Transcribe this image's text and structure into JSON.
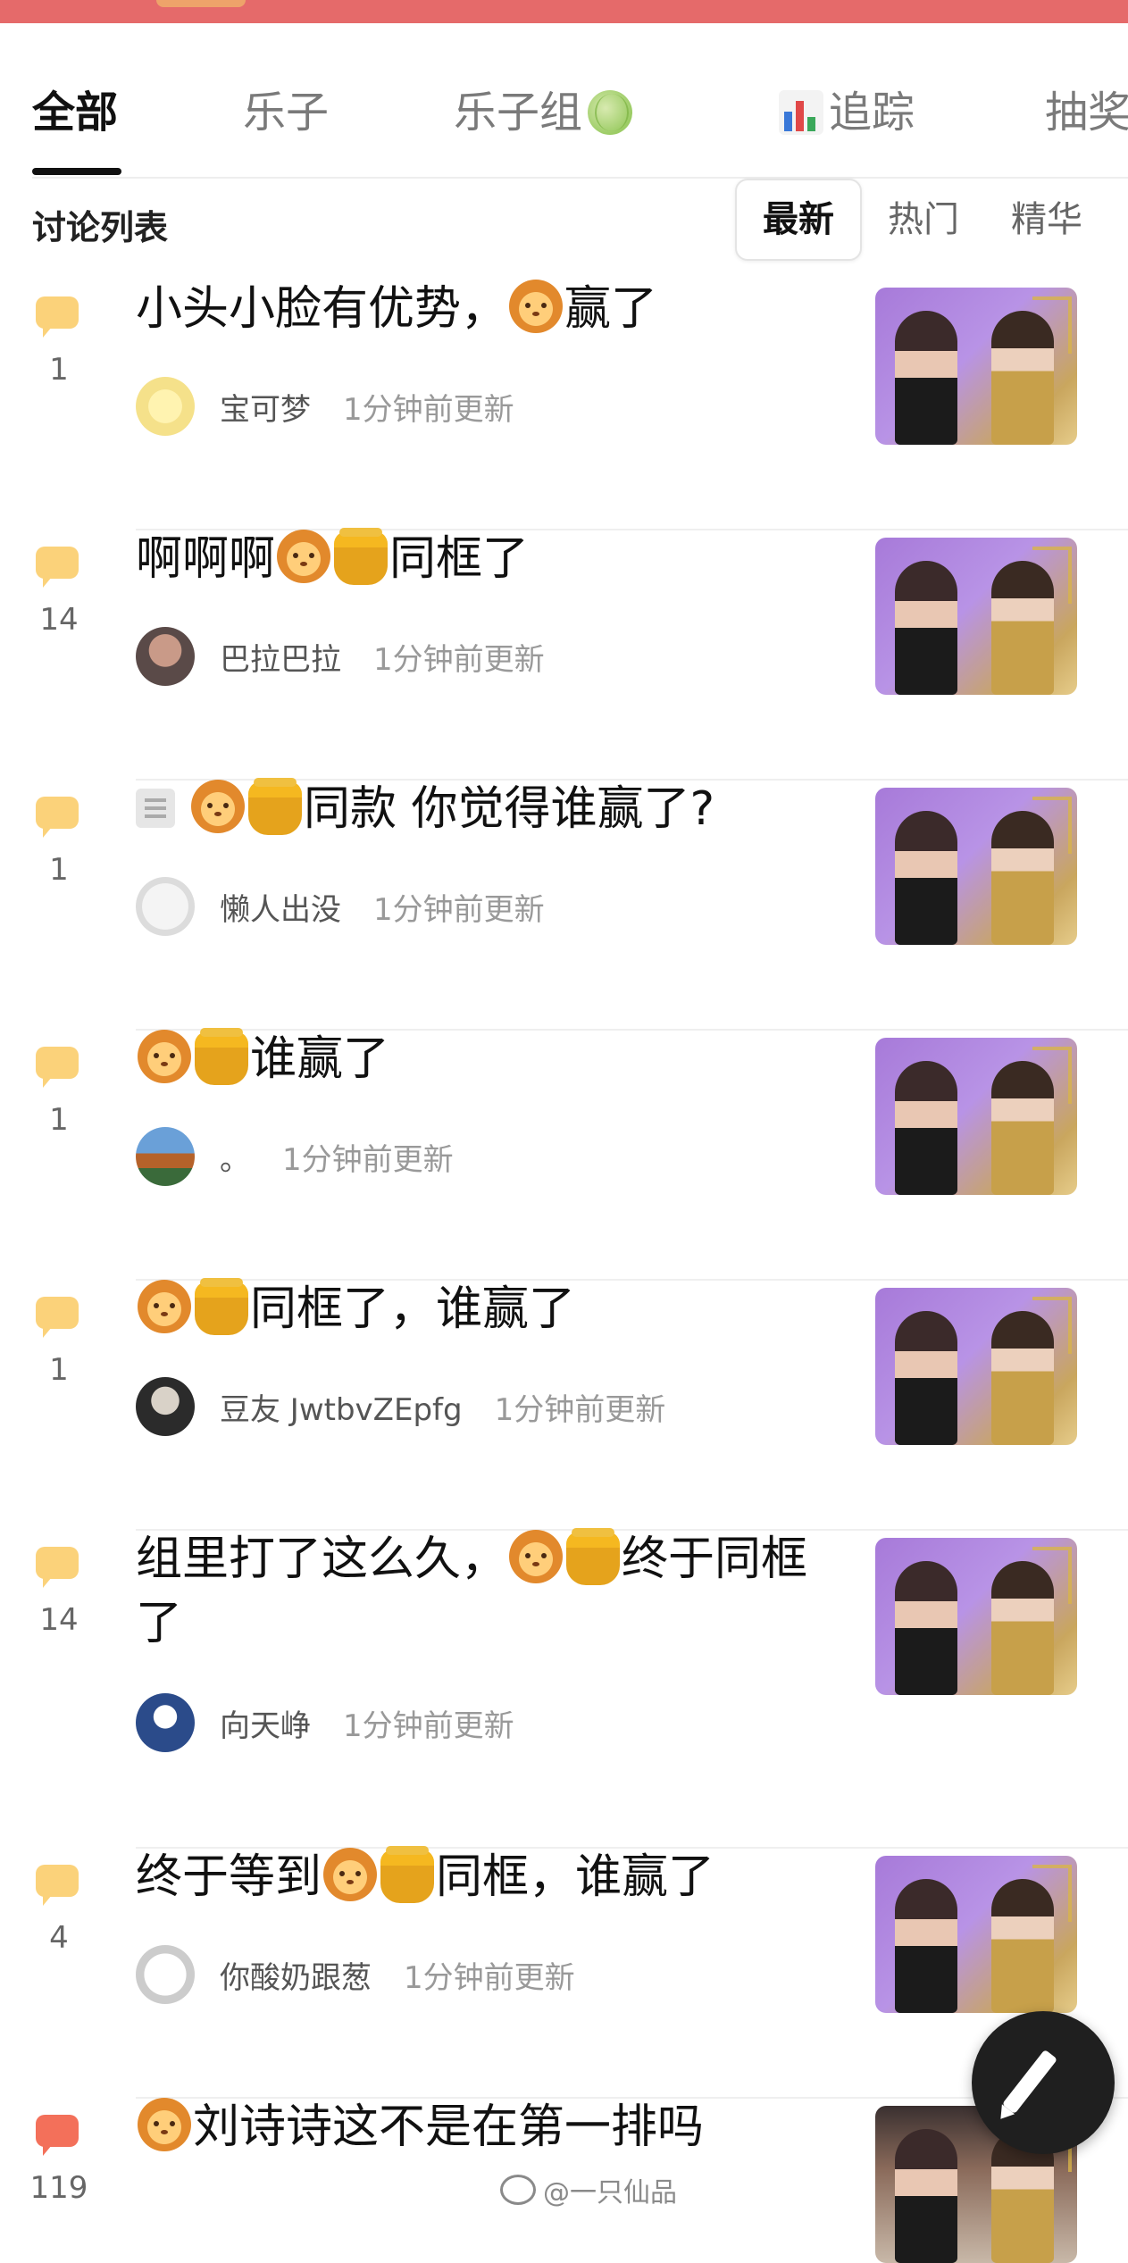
{
  "tabs": [
    {
      "label": "全部",
      "active": true
    },
    {
      "label": "乐子",
      "active": false
    },
    {
      "label": "乐子组",
      "icon": "melon-icon",
      "active": false
    },
    {
      "label": "追踪",
      "icon": "bar-chart-icon",
      "active": false
    },
    {
      "label": "抽奖",
      "active": false
    }
  ],
  "section": {
    "title": "讨论列表"
  },
  "sort": [
    {
      "label": "最新",
      "active": true
    },
    {
      "label": "热门",
      "active": false
    },
    {
      "label": "精华",
      "active": false
    }
  ],
  "emoji_names": {
    "lion": "lion-face-icon",
    "honey": "honey-pot-icon"
  },
  "colors": {
    "comment_badge": "#fbd27a",
    "comment_badge_hot": "#f3705a",
    "top_strip": "#e56a6a"
  },
  "posts": [
    {
      "count": "1",
      "title_parts": [
        "小头小脸有优势，",
        "[lion]",
        "赢了"
      ],
      "author": "宝可梦",
      "time": "1分钟前更新"
    },
    {
      "count": "14",
      "title_parts": [
        "啊啊啊",
        "[lion]",
        "[honey]",
        "同框了"
      ],
      "author": "巴拉巴拉",
      "time": "1分钟前更新"
    },
    {
      "count": "1",
      "doc": true,
      "title_parts": [
        "[lion]",
        "[honey]",
        "同款 你觉得谁赢了?"
      ],
      "author": "懒人出没",
      "time": "1分钟前更新"
    },
    {
      "count": "1",
      "title_parts": [
        "[lion]",
        "[honey]",
        "谁赢了"
      ],
      "author": "。",
      "time": "1分钟前更新"
    },
    {
      "count": "1",
      "title_parts": [
        "[lion]",
        "[honey]",
        "同框了，谁赢了"
      ],
      "author": "豆友 JwtbvZEpfg",
      "time": "1分钟前更新"
    },
    {
      "count": "14",
      "title_parts": [
        "组里打了这么久，",
        "[lion]",
        "[honey]",
        "终于同框了"
      ],
      "author": "向天峥",
      "time": "1分钟前更新"
    },
    {
      "count": "4",
      "title_parts": [
        "终于等到",
        "[lion]",
        "[honey]",
        "同框，谁赢了"
      ],
      "author": "你酸奶跟葱",
      "time": "1分钟前更新"
    },
    {
      "count": "119",
      "hot": true,
      "title_parts": [
        "[lion]",
        "刘诗诗这不是在第一排吗"
      ],
      "author": "",
      "time": ""
    }
  ],
  "watermark": "@一只仙品"
}
